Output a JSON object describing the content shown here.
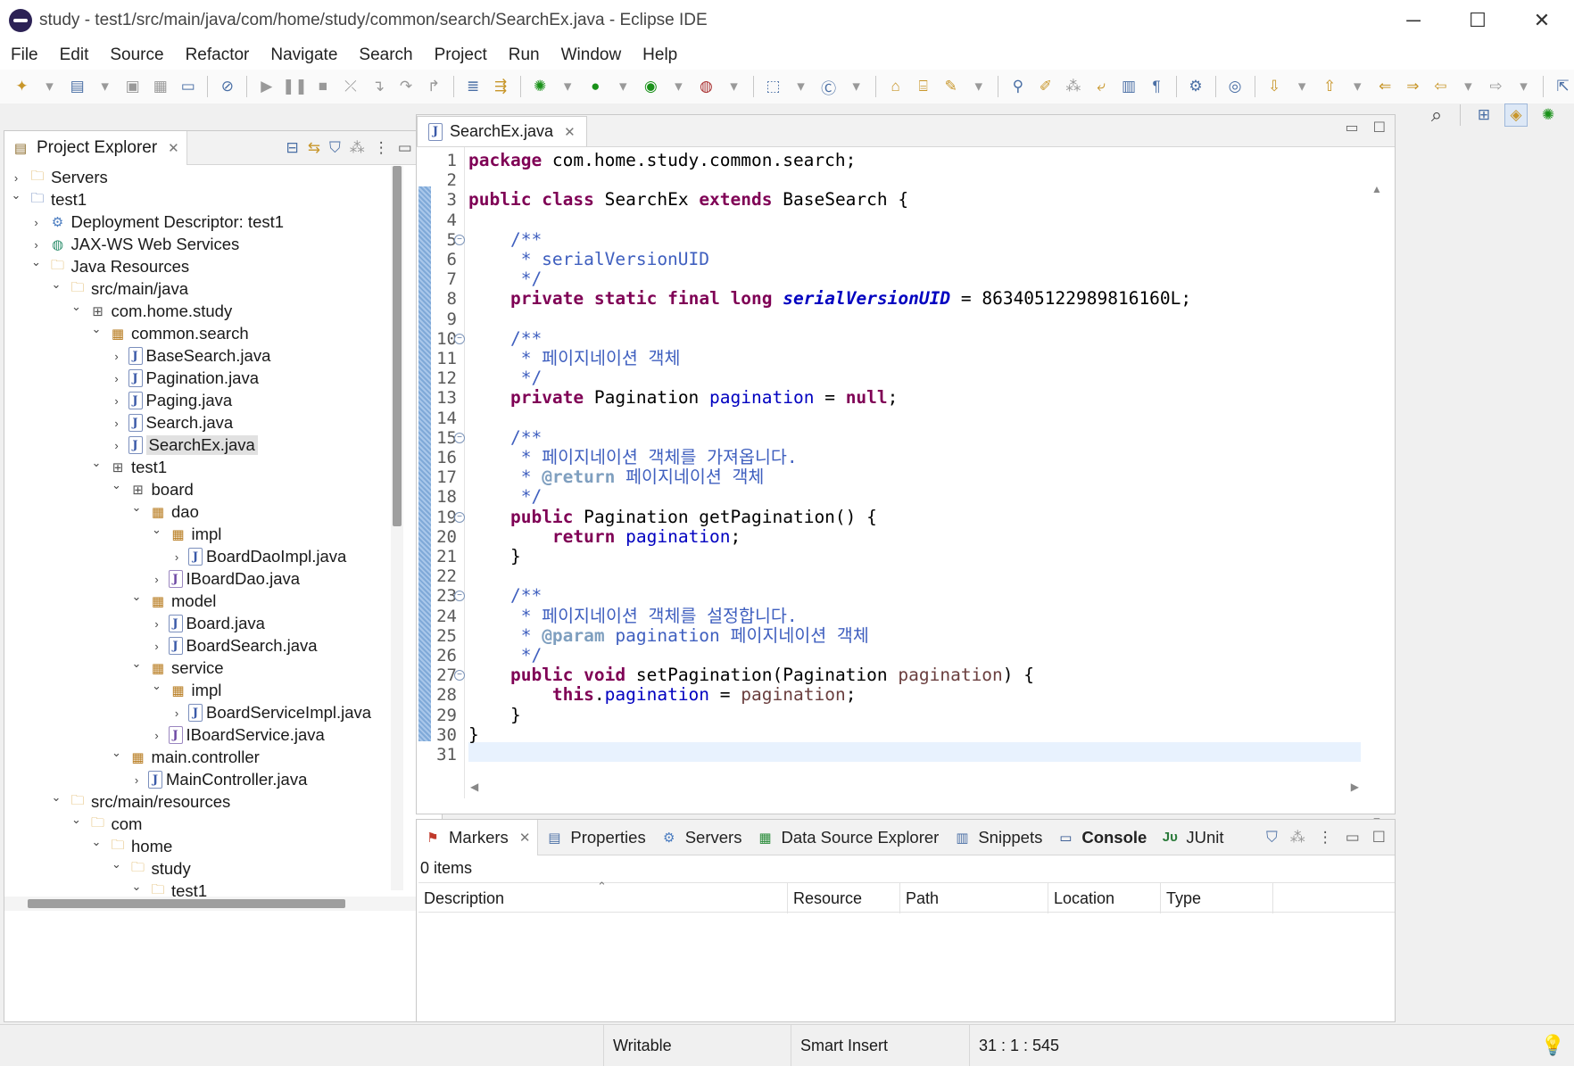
{
  "window": {
    "title": "study - test1/src/main/java/com/home/study/common/search/SearchEx.java - Eclipse IDE",
    "minimize": "─",
    "maximize": "☐",
    "close": "✕"
  },
  "menu": [
    "File",
    "Edit",
    "Source",
    "Refactor",
    "Navigate",
    "Search",
    "Project",
    "Run",
    "Window",
    "Help"
  ],
  "explorer": {
    "title": "Project Explorer",
    "tree": [
      {
        "label": "Servers",
        "depth": 0,
        "arrow": "›",
        "icon": "folder"
      },
      {
        "label": "test1",
        "depth": 0,
        "arrow": "⌄",
        "icon": "project"
      },
      {
        "label": "Deployment Descriptor: test1",
        "depth": 1,
        "arrow": "›",
        "icon": "descriptor"
      },
      {
        "label": "JAX-WS Web Services",
        "depth": 1,
        "arrow": "›",
        "icon": "globe"
      },
      {
        "label": "Java Resources",
        "depth": 1,
        "arrow": "⌄",
        "icon": "folder"
      },
      {
        "label": "src/main/java",
        "depth": 2,
        "arrow": "⌄",
        "icon": "folder"
      },
      {
        "label": "com.home.study",
        "depth": 3,
        "arrow": "⌄",
        "icon": "pkgroot"
      },
      {
        "label": "common.search",
        "depth": 4,
        "arrow": "⌄",
        "icon": "package"
      },
      {
        "label": "BaseSearch.java",
        "depth": 5,
        "arrow": "›",
        "icon": "java"
      },
      {
        "label": "Pagination.java",
        "depth": 5,
        "arrow": "›",
        "icon": "java"
      },
      {
        "label": "Paging.java",
        "depth": 5,
        "arrow": "›",
        "icon": "java"
      },
      {
        "label": "Search.java",
        "depth": 5,
        "arrow": "›",
        "icon": "java"
      },
      {
        "label": "SearchEx.java",
        "depth": 5,
        "arrow": "›",
        "icon": "java",
        "selected": true
      },
      {
        "label": "test1",
        "depth": 4,
        "arrow": "⌄",
        "icon": "pkgroot"
      },
      {
        "label": "board",
        "depth": 5,
        "arrow": "⌄",
        "icon": "pkgroot"
      },
      {
        "label": "dao",
        "depth": 6,
        "arrow": "⌄",
        "icon": "package"
      },
      {
        "label": "impl",
        "depth": 7,
        "arrow": "⌄",
        "icon": "package"
      },
      {
        "label": "BoardDaoImpl.java",
        "depth": 8,
        "arrow": "›",
        "icon": "java"
      },
      {
        "label": "IBoardDao.java",
        "depth": 7,
        "arrow": "›",
        "icon": "iface"
      },
      {
        "label": "model",
        "depth": 6,
        "arrow": "⌄",
        "icon": "package"
      },
      {
        "label": "Board.java",
        "depth": 7,
        "arrow": "›",
        "icon": "java"
      },
      {
        "label": "BoardSearch.java",
        "depth": 7,
        "arrow": "›",
        "icon": "java"
      },
      {
        "label": "service",
        "depth": 6,
        "arrow": "⌄",
        "icon": "package"
      },
      {
        "label": "impl",
        "depth": 7,
        "arrow": "⌄",
        "icon": "package"
      },
      {
        "label": "BoardServiceImpl.java",
        "depth": 8,
        "arrow": "›",
        "icon": "java"
      },
      {
        "label": "IBoardService.java",
        "depth": 7,
        "arrow": "›",
        "icon": "iface"
      },
      {
        "label": "main.controller",
        "depth": 5,
        "arrow": "⌄",
        "icon": "package"
      },
      {
        "label": "MainController.java",
        "depth": 6,
        "arrow": "›",
        "icon": "java"
      },
      {
        "label": "src/main/resources",
        "depth": 2,
        "arrow": "⌄",
        "icon": "folder"
      },
      {
        "label": "com",
        "depth": 3,
        "arrow": "⌄",
        "icon": "folder"
      },
      {
        "label": "home",
        "depth": 4,
        "arrow": "⌄",
        "icon": "folder"
      },
      {
        "label": "study",
        "depth": 5,
        "arrow": "⌄",
        "icon": "folder"
      },
      {
        "label": "test1",
        "depth": 6,
        "arrow": "⌄",
        "icon": "folder"
      }
    ]
  },
  "editor": {
    "tab_label": "SearchEx.java",
    "line_numbers": [
      "1",
      "2",
      "3",
      "4",
      "5",
      "6",
      "7",
      "8",
      "9",
      "10",
      "11",
      "12",
      "13",
      "14",
      "15",
      "16",
      "17",
      "18",
      "19",
      "20",
      "21",
      "22",
      "23",
      "24",
      "25",
      "26",
      "27",
      "28",
      "29",
      "30",
      "31"
    ],
    "fold_lines": [
      5,
      10,
      15,
      19,
      23,
      27
    ],
    "code": [
      [
        {
          "t": "package",
          "c": "kw"
        },
        {
          "t": " com.home.study.common.search;"
        }
      ],
      [],
      [
        {
          "t": "public",
          "c": "kw"
        },
        {
          "t": " "
        },
        {
          "t": "class",
          "c": "kw"
        },
        {
          "t": " SearchEx "
        },
        {
          "t": "extends",
          "c": "kw"
        },
        {
          "t": " BaseSearch {"
        }
      ],
      [],
      [
        {
          "t": "    "
        },
        {
          "t": "/**",
          "c": "cm"
        }
      ],
      [
        {
          "t": "     * serialVersionUID",
          "c": "cm"
        }
      ],
      [
        {
          "t": "     */",
          "c": "cm"
        }
      ],
      [
        {
          "t": "    "
        },
        {
          "t": "private",
          "c": "kw"
        },
        {
          "t": " "
        },
        {
          "t": "static",
          "c": "kw"
        },
        {
          "t": " "
        },
        {
          "t": "final",
          "c": "kw"
        },
        {
          "t": " "
        },
        {
          "t": "long",
          "c": "kw"
        },
        {
          "t": " "
        },
        {
          "t": "serialVersionUID",
          "c": "sfld"
        },
        {
          "t": " = 863405122989816160L;"
        }
      ],
      [],
      [
        {
          "t": "    "
        },
        {
          "t": "/**",
          "c": "cm"
        }
      ],
      [
        {
          "t": "     * 페이지네이션 객체",
          "c": "cm"
        }
      ],
      [
        {
          "t": "     */",
          "c": "cm"
        }
      ],
      [
        {
          "t": "    "
        },
        {
          "t": "private",
          "c": "kw"
        },
        {
          "t": " Pagination "
        },
        {
          "t": "pagination",
          "c": "fld"
        },
        {
          "t": " = "
        },
        {
          "t": "null",
          "c": "kw"
        },
        {
          "t": ";"
        }
      ],
      [],
      [
        {
          "t": "    "
        },
        {
          "t": "/**",
          "c": "cm"
        }
      ],
      [
        {
          "t": "     * 페이지네이션 객체를 가져옵니다.",
          "c": "cm"
        }
      ],
      [
        {
          "t": "     * ",
          "c": "cm"
        },
        {
          "t": "@return",
          "c": "tag"
        },
        {
          "t": " 페이지네이션 객체",
          "c": "cm"
        }
      ],
      [
        {
          "t": "     */",
          "c": "cm"
        }
      ],
      [
        {
          "t": "    "
        },
        {
          "t": "public",
          "c": "kw"
        },
        {
          "t": " Pagination getPagination() {"
        }
      ],
      [
        {
          "t": "        "
        },
        {
          "t": "return",
          "c": "kw"
        },
        {
          "t": " "
        },
        {
          "t": "pagination",
          "c": "fld"
        },
        {
          "t": ";"
        }
      ],
      [
        {
          "t": "    }"
        }
      ],
      [],
      [
        {
          "t": "    "
        },
        {
          "t": "/**",
          "c": "cm"
        }
      ],
      [
        {
          "t": "     * 페이지네이션 객체를 설정합니다.",
          "c": "cm"
        }
      ],
      [
        {
          "t": "     * ",
          "c": "cm"
        },
        {
          "t": "@param",
          "c": "tag"
        },
        {
          "t": " pagination 페이지네이션 객체",
          "c": "cm"
        }
      ],
      [
        {
          "t": "     */",
          "c": "cm"
        }
      ],
      [
        {
          "t": "    "
        },
        {
          "t": "public",
          "c": "kw"
        },
        {
          "t": " "
        },
        {
          "t": "void",
          "c": "kw"
        },
        {
          "t": " setPagination(Pagination "
        },
        {
          "t": "pagination",
          "c": "prm"
        },
        {
          "t": ") {"
        }
      ],
      [
        {
          "t": "        "
        },
        {
          "t": "this",
          "c": "kw"
        },
        {
          "t": "."
        },
        {
          "t": "pagination",
          "c": "fld"
        },
        {
          "t": " = "
        },
        {
          "t": "pagination",
          "c": "prm"
        },
        {
          "t": ";"
        }
      ],
      [
        {
          "t": "    }"
        }
      ],
      [
        {
          "t": "}"
        }
      ],
      []
    ]
  },
  "bottom": {
    "tabs": [
      {
        "label": "Markers",
        "icon": "markers-icon",
        "active": true
      },
      {
        "label": "Properties",
        "icon": "properties-icon"
      },
      {
        "label": "Servers",
        "icon": "servers-icon"
      },
      {
        "label": "Data Source Explorer",
        "icon": "datasource-icon"
      },
      {
        "label": "Snippets",
        "icon": "snippets-icon"
      },
      {
        "label": "Console",
        "icon": "console-icon",
        "bold": true
      },
      {
        "label": "JUnit",
        "icon": "junit-icon"
      }
    ],
    "items_count": "0 items",
    "columns": [
      "Description",
      "Resource",
      "Path",
      "Location",
      "Type"
    ]
  },
  "status": {
    "writable": "Writable",
    "insert_mode": "Smart Insert",
    "position": "31 : 1 : 545"
  },
  "colors": {
    "keyword": "#7f0055",
    "comment": "#3f5fbf",
    "field": "#0000c0",
    "current_line": "#e8f2fe"
  }
}
